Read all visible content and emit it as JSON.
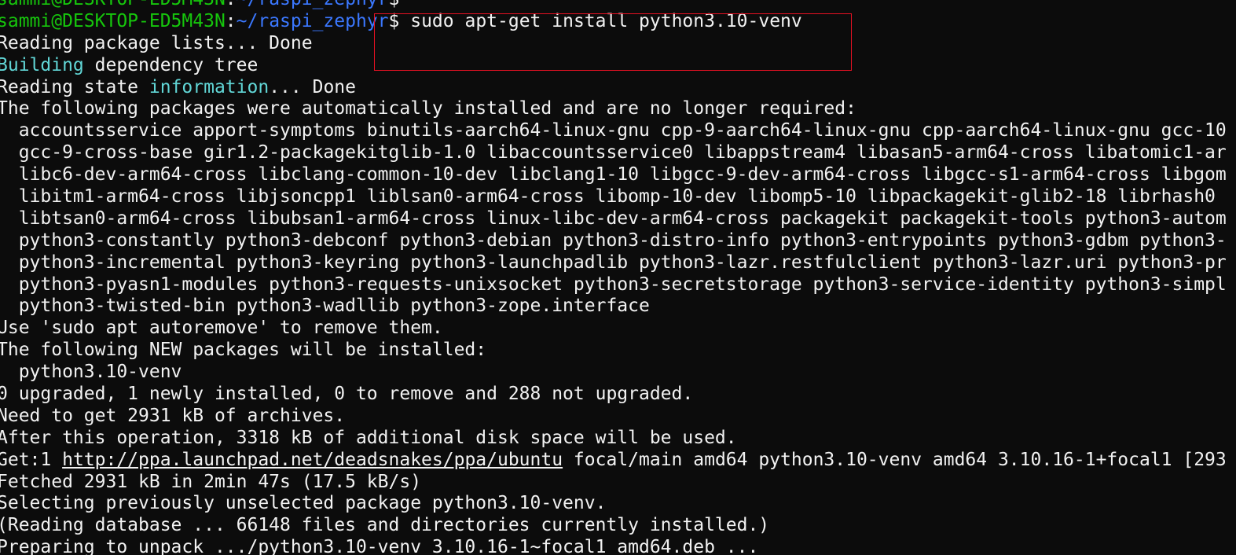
{
  "terminal": {
    "prompt": {
      "user_host": "sammi@DESKTOP-ED5M43N",
      "separator": ":",
      "path": "~/raspi_zephyr",
      "symbol": "$"
    },
    "command": " sudo apt-get install python3.10-venv",
    "colors": {
      "background": "#0c0c0c",
      "foreground": "#f2f2f2",
      "prompt_user": "#16c60c",
      "prompt_path": "#3b78ff",
      "keyword": "#61d6d6",
      "highlight_box": "#e81123"
    },
    "output": {
      "reading_lists": "Reading package lists... Done",
      "building_word": "Building",
      "building_rest": " dependency tree",
      "state_pre": "Reading state ",
      "state_word": "information",
      "state_post": "... Done",
      "auto_header": "The following packages were automatically installed and are no longer required:",
      "auto_packages": [
        "  accountsservice apport-symptoms binutils-aarch64-linux-gnu cpp-9-aarch64-linux-gnu cpp-aarch64-linux-gnu gcc-10",
        "  gcc-9-cross-base gir1.2-packagekitglib-1.0 libaccountsservice0 libappstream4 libasan5-arm64-cross libatomic1-ar",
        "  libc6-dev-arm64-cross libclang-common-10-dev libclang1-10 libgcc-9-dev-arm64-cross libgcc-s1-arm64-cross libgom",
        "  libitm1-arm64-cross libjsoncpp1 liblsan0-arm64-cross libomp-10-dev libomp5-10 libpackagekit-glib2-18 librhash0",
        "  libtsan0-arm64-cross libubsan1-arm64-cross linux-libc-dev-arm64-cross packagekit packagekit-tools python3-autom",
        "  python3-constantly python3-debconf python3-debian python3-distro-info python3-entrypoints python3-gdbm python3-",
        "  python3-incremental python3-keyring python3-launchpadlib python3-lazr.restfulclient python3-lazr.uri python3-pr",
        "  python3-pyasn1-modules python3-requests-unixsocket python3-secretstorage python3-service-identity python3-simpl",
        "  python3-twisted-bin python3-wadllib python3-zope.interface"
      ],
      "autoremove": "Use 'sudo apt autoremove' to remove them.",
      "new_header": "The following NEW packages will be installed:",
      "new_package": "  python3.10-venv",
      "summary": "0 upgraded, 1 newly installed, 0 to remove and 288 not upgraded.",
      "need": "Need to get 2931 kB of archives.",
      "after": "After this operation, 3318 kB of additional disk space will be used.",
      "get_prefix": "Get:1 ",
      "get_url": "http://ppa.launchpad.net/deadsnakes/ppa/ubuntu",
      "get_suffix": " focal/main amd64 python3.10-venv amd64 3.10.16-1+focal1 [293",
      "fetched": "Fetched 2931 kB in 2min 47s (17.5 kB/s)",
      "selecting": "Selecting previously unselected package python3.10-venv.",
      "reading_db": "(Reading database ... 66148 files and directories currently installed.)",
      "preparing": "Preparing to unpack .../python3.10-venv_3.10.16-1~focal1_amd64.deb ..."
    }
  }
}
